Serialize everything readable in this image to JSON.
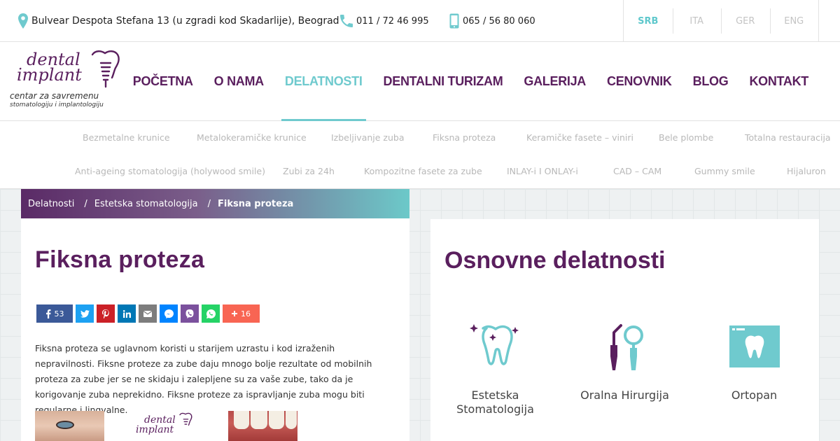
{
  "topbar": {
    "address": "Bulvear Despota Stefana 13 (u zgradi kod Skadarlije), Beograd",
    "phone": "011 / 72 46 995",
    "mobile": "065 / 56 80 060",
    "languages": [
      "SRB",
      "ITA",
      "GER",
      "ENG"
    ],
    "active_language": "SRB",
    "icons": {
      "address": "map-pin-icon",
      "phone": "phone-icon",
      "mobile": "mobile-phone-icon"
    }
  },
  "logo": {
    "line1": "dental",
    "line2": "implant",
    "sub1": "centar za savremenu",
    "sub2": "stomatologiju i implantologiju"
  },
  "nav": {
    "items": [
      "POČETNA",
      "O NAMA",
      "DELATNOSTI",
      "DENTALNI TURIZAM",
      "GALERIJA",
      "CENOVNIK",
      "BLOG",
      "KONTAKT"
    ],
    "active": "DELATNOSTI"
  },
  "subnav": {
    "row1": [
      "Bezmetalne krunice",
      "Metalokeramičke krunice",
      "Izbeljivanje zuba",
      "Fiksna proteza",
      "Keramičke fasete – viniri",
      "Bele plombe",
      "Totalna restauracija"
    ],
    "row2": [
      "Anti-ageing stomatologija (holywood smile)",
      "Zubi za 24h",
      "Kompozitne fasete za zube",
      "INLAY-i I ONLAY-i",
      "CAD – CAM",
      "Gummy smile",
      "Hijaluron"
    ]
  },
  "breadcrumb": {
    "items": [
      "Delatnosti",
      "Estetska stomatologija"
    ],
    "separator": "/",
    "current": "Fiksna proteza"
  },
  "article": {
    "title": "Fiksna proteza",
    "body": "Fiksna proteza se uglavnom koristi u starijem uzrastu i kod izraženih nepravilnosti. Fiksne proteze za zube daju mnogo bolje rezultate od mobilnih proteza za zube jer se ne skidaju i zalepljene su za vaše zube, tako da je korigovanje zuba neprekidno. Fiksne proteze za ispravljanje zuba mogu biti regularne i lingvalne.",
    "thumb_logo": [
      "dental",
      "implant"
    ]
  },
  "share": {
    "facebook_count": "53",
    "more_count": "16",
    "buttons": [
      "facebook",
      "twitter",
      "pinterest",
      "linkedin",
      "email",
      "messenger",
      "viber",
      "whatsapp",
      "more"
    ],
    "colors": {
      "facebook": "#3b5998",
      "twitter": "#1da1f2",
      "pinterest": "#cb2027",
      "linkedin": "#0077b5",
      "email": "#7d7d7d",
      "messenger": "#0084ff",
      "viber": "#7b519d",
      "whatsapp": "#25d366",
      "more": "#f86553"
    }
  },
  "services": {
    "title": "Osnovne delatnosti",
    "items": [
      {
        "label1": "Estetska",
        "label2": "Stomatologija",
        "icon": "sparkling-tooth-icon"
      },
      {
        "label1": "Oralna Hirurgija",
        "label2": "",
        "icon": "dental-tools-icon"
      },
      {
        "label1": "Ortopan",
        "label2": "",
        "icon": "x-ray-tooth-icon"
      }
    ]
  },
  "colors": {
    "brand_purple": "#5a1f5e",
    "accent_teal": "#6fcace",
    "muted_text": "#b8b8b8"
  }
}
